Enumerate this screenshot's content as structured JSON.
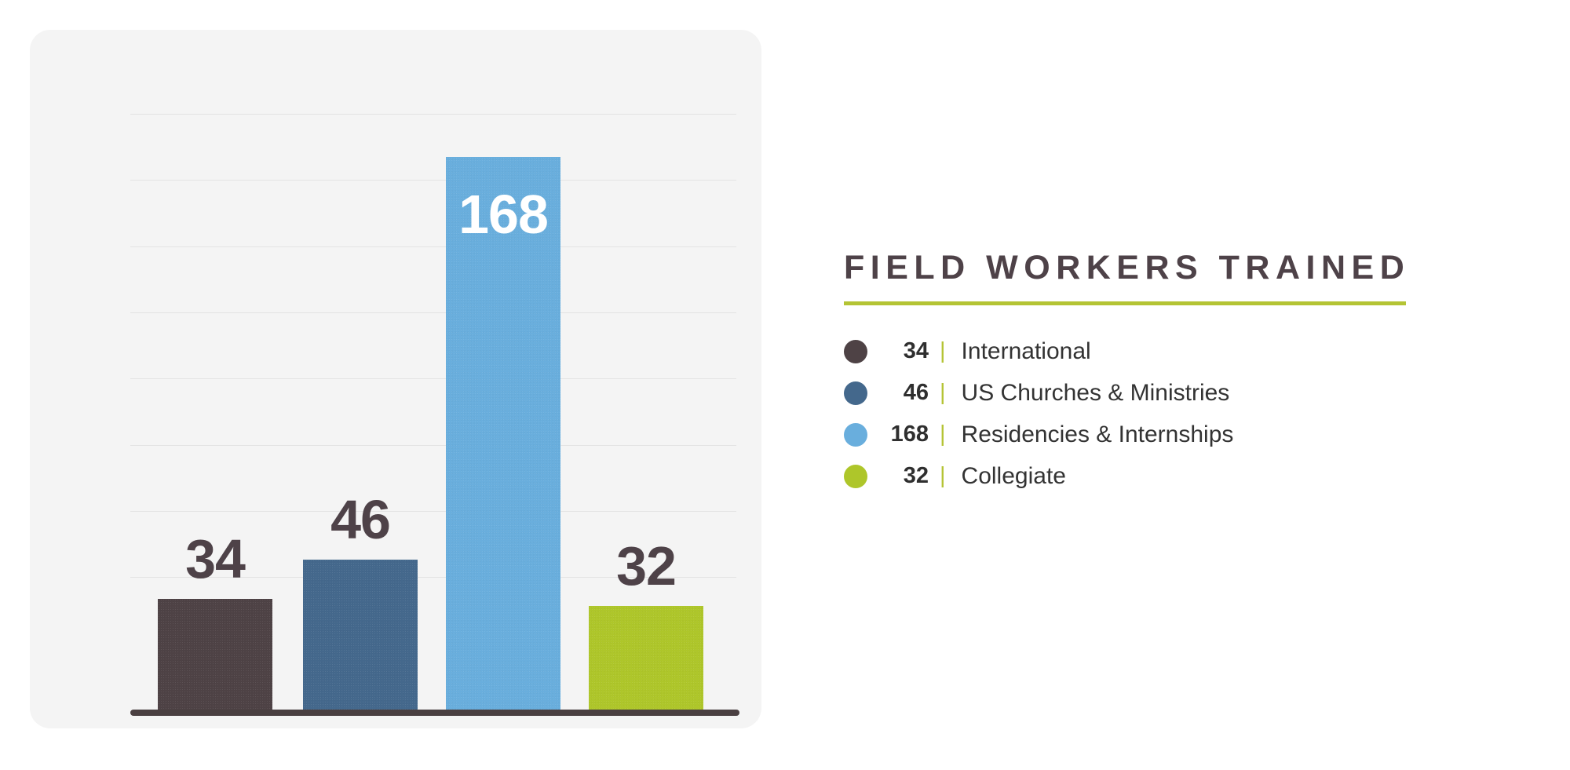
{
  "chart_data": {
    "type": "bar",
    "title": "FIELD WORKERS TRAINED",
    "categories": [
      "International",
      "US Churches & Ministries",
      "Residencies & Internships",
      "Collegiate"
    ],
    "values": [
      34,
      46,
      168,
      32
    ],
    "colors": [
      "#4e4245",
      "#44688c",
      "#69aedd",
      "#aec62a"
    ],
    "xlabel": "",
    "ylabel": "",
    "ylim": [
      0,
      194
    ],
    "grid": true,
    "gridline_count": 8,
    "legend_position": "right",
    "value_labels": [
      "34",
      "46",
      "168",
      "32"
    ]
  },
  "card": {
    "background_color": "#f4f4f4",
    "baseline_color": "#4a3f41",
    "gridline_color": "#e3e3e3"
  },
  "legend": {
    "title": "FIELD WORKERS TRAINED",
    "title_color": "#4e4248",
    "underline_color": "#b4c434",
    "separator": "|",
    "separator_color": "#b4c434",
    "items": [
      {
        "value": "34",
        "label": "International",
        "color": "#4e4245"
      },
      {
        "value": "46",
        "label": "US Churches & Ministries",
        "color": "#44688c"
      },
      {
        "value": "168",
        "label": "Residencies & Internships",
        "color": "#69aedd"
      },
      {
        "value": "32",
        "label": "Collegiate",
        "color": "#aec62a"
      }
    ]
  }
}
